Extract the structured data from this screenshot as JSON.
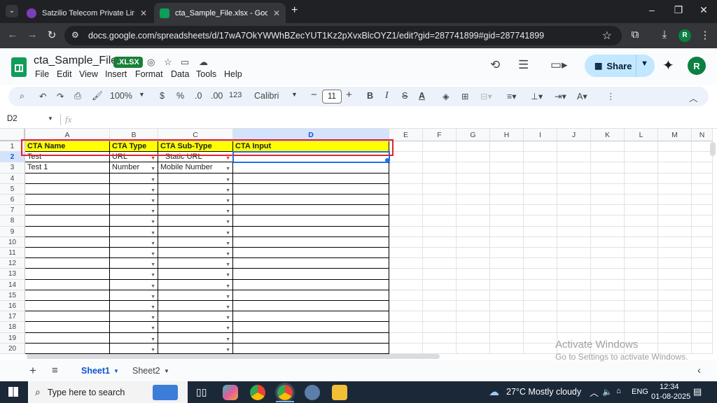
{
  "browser": {
    "tabs": [
      {
        "title": "Satzilio Telecom Private Limited",
        "favicon_color": "#7b3fb5"
      },
      {
        "title": "cta_Sample_File.xlsx - Google Sh",
        "favicon_color": "#0f9d58"
      }
    ],
    "url": "docs.google.com/spreadsheets/d/17wA7OkYWWhBZecYUT1Kz2pXvxBlcOYZ1/edit?gid=287741899#gid=287741899",
    "profile_initial": "R"
  },
  "doc": {
    "title": "cta_Sample_File",
    "badge": ".XLSX",
    "menu": [
      "File",
      "Edit",
      "View",
      "Insert",
      "Format",
      "Data",
      "Tools",
      "Help"
    ],
    "share_label": "Share",
    "user_initial": "R"
  },
  "toolbar": {
    "zoom": "100%",
    "currency": "$",
    "percent": "%",
    "dec_decrease": ".0",
    "dec_increase": ".00",
    "number_format": "123",
    "font": "Calibri",
    "font_size": "11"
  },
  "formula_bar": {
    "name_box": "D2",
    "fx": "fx",
    "value": ""
  },
  "grid": {
    "columns": [
      "A",
      "B",
      "C",
      "D",
      "E",
      "F",
      "G",
      "H",
      "I",
      "J",
      "K",
      "L",
      "M",
      "N"
    ],
    "selected_column": "D",
    "selected_row": 2,
    "rows": [
      "1",
      "2",
      "3",
      "4",
      "5",
      "6",
      "7",
      "8",
      "9",
      "10",
      "11",
      "12",
      "13",
      "14",
      "15",
      "16",
      "17",
      "18",
      "19",
      "20"
    ],
    "header_row": [
      "CTA Name",
      "CTA Type",
      "CTA Sub-Type",
      "CTA Input"
    ],
    "data_rows": [
      [
        "Test",
        "URL",
        "Static URL",
        ""
      ],
      [
        "Test 1",
        "Number",
        "Mobile Number",
        ""
      ]
    ],
    "header_fill": "#ffff00",
    "highlight_color": "#e0242b"
  },
  "sheets": {
    "tabs": [
      "Sheet1",
      "Sheet2"
    ],
    "active": "Sheet1"
  },
  "watermark": {
    "title": "Activate Windows",
    "subtitle": "Go to Settings to activate Windows."
  },
  "taskbar": {
    "search_placeholder": "Type here to search",
    "weather": "27°C  Mostly cloudy",
    "language": "ENG",
    "time": "12:34",
    "date": "01-08-2025"
  }
}
